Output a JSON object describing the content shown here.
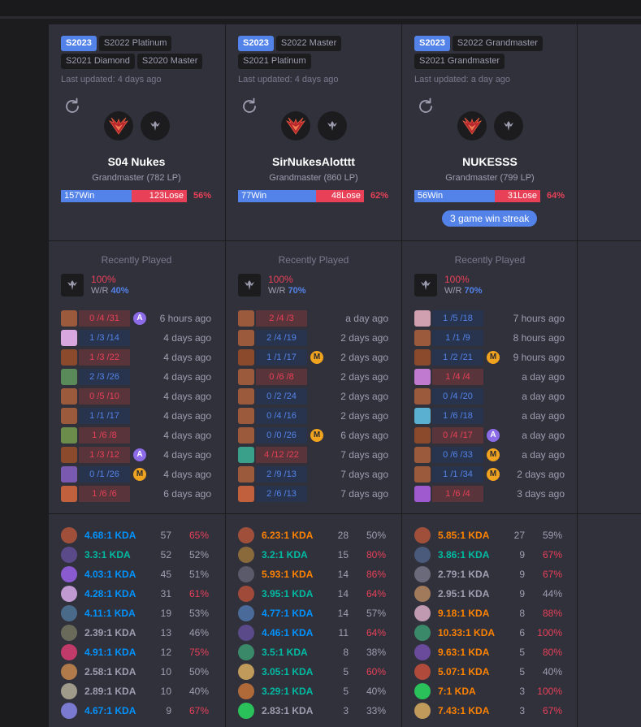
{
  "colors": {
    "win": "#5383e8",
    "lose": "#e84057",
    "bg": "#31313c",
    "dark": "#1c1c1f"
  },
  "recent_played_title": "Recently Played",
  "wr_label": "W/R",
  "players": [
    {
      "seasons": [
        {
          "label": "S2023",
          "current": true
        },
        {
          "label": "S2022 Platinum"
        },
        {
          "label": "S2021 Diamond"
        },
        {
          "label": "S2020 Master"
        }
      ],
      "last_updated": "Last updated: 4 days ago",
      "name": "S04 Nukes",
      "rank": "Grandmaster (782 LP)",
      "wins": "157Win",
      "losses": "123Lose",
      "winrate": "56%",
      "win_fraction": 0.56,
      "streak": "",
      "recent": {
        "pct": "100%",
        "wr": "40%"
      },
      "games": [
        {
          "champ": "#9c5a3c",
          "kda": "0 /4 /31",
          "result": "lose",
          "badge": "A",
          "ago": "6 hours ago"
        },
        {
          "champ": "#d8a7e0",
          "kda": "1 /3 /14",
          "result": "win",
          "badge": "",
          "ago": "4 days ago"
        },
        {
          "champ": "#8b4a2b",
          "kda": "1 /3 /22",
          "result": "lose",
          "badge": "",
          "ago": "4 days ago"
        },
        {
          "champ": "#5a8a5a",
          "kda": "2 /3 /26",
          "result": "win",
          "badge": "",
          "ago": "4 days ago"
        },
        {
          "champ": "#9c5a3c",
          "kda": "0 /5 /10",
          "result": "lose",
          "badge": "",
          "ago": "4 days ago"
        },
        {
          "champ": "#9c5a3c",
          "kda": "1 /1 /17",
          "result": "win",
          "badge": "",
          "ago": "4 days ago"
        },
        {
          "champ": "#6b8c4a",
          "kda": "1 /6 /8",
          "result": "lose",
          "badge": "",
          "ago": "4 days ago"
        },
        {
          "champ": "#8b4a2b",
          "kda": "1 /3 /12",
          "result": "lose",
          "badge": "A",
          "ago": "4 days ago"
        },
        {
          "champ": "#7a5ab0",
          "kda": "0 /1 /26",
          "result": "win",
          "badge": "M",
          "ago": "4 days ago"
        },
        {
          "champ": "#c0603c",
          "kda": "1 /6 /6",
          "result": "lose",
          "badge": "",
          "ago": "6 days ago"
        }
      ],
      "champions": [
        {
          "icon": "#a0503a",
          "kda": "4.68:1 KDA",
          "tier": "blue",
          "games": "57",
          "wr": "65%",
          "hot": true
        },
        {
          "icon": "#5a4a8a",
          "kda": "3.3:1 KDA",
          "tier": "green",
          "games": "52",
          "wr": "52%",
          "hot": false
        },
        {
          "icon": "#8a5ad0",
          "kda": "4.03:1 KDA",
          "tier": "blue",
          "games": "45",
          "wr": "51%",
          "hot": false
        },
        {
          "icon": "#c09ad0",
          "kda": "4.28:1 KDA",
          "tier": "blue",
          "games": "31",
          "wr": "61%",
          "hot": true
        },
        {
          "icon": "#4a6a8a",
          "kda": "4.11:1 KDA",
          "tier": "blue",
          "games": "19",
          "wr": "53%",
          "hot": false
        },
        {
          "icon": "#6a6a5a",
          "kda": "2.39:1 KDA",
          "tier": "gray",
          "games": "13",
          "wr": "46%",
          "hot": false
        },
        {
          "icon": "#c03a6a",
          "kda": "4.91:1 KDA",
          "tier": "blue",
          "games": "12",
          "wr": "75%",
          "hot": true
        },
        {
          "icon": "#b07a4a",
          "kda": "2.58:1 KDA",
          "tier": "gray",
          "games": "10",
          "wr": "50%",
          "hot": false
        },
        {
          "icon": "#a09a8a",
          "kda": "2.89:1 KDA",
          "tier": "gray",
          "games": "10",
          "wr": "40%",
          "hot": false
        },
        {
          "icon": "#7a7ad0",
          "kda": "4.67:1 KDA",
          "tier": "blue",
          "games": "9",
          "wr": "67%",
          "hot": true
        }
      ]
    },
    {
      "seasons": [
        {
          "label": "S2023",
          "current": true
        },
        {
          "label": "S2022 Master"
        },
        {
          "label": "S2021 Platinum"
        }
      ],
      "last_updated": "Last updated: 4 days ago",
      "name": "SirNukesAlotttt",
      "rank": "Grandmaster (860 LP)",
      "wins": "77Win",
      "losses": "48Lose",
      "winrate": "62%",
      "win_fraction": 0.62,
      "streak": "",
      "recent": {
        "pct": "100%",
        "wr": "70%"
      },
      "games": [
        {
          "champ": "#9c5a3c",
          "kda": "2 /4 /3",
          "result": "lose",
          "badge": "",
          "ago": "a day ago"
        },
        {
          "champ": "#9c5a3c",
          "kda": "2 /4 /19",
          "result": "win",
          "badge": "",
          "ago": "2 days ago"
        },
        {
          "champ": "#8b4a2b",
          "kda": "1 /1 /17",
          "result": "win",
          "badge": "M",
          "ago": "2 days ago"
        },
        {
          "champ": "#9c5a3c",
          "kda": "0 /6 /8",
          "result": "lose",
          "badge": "",
          "ago": "2 days ago"
        },
        {
          "champ": "#9c5a3c",
          "kda": "0 /2 /24",
          "result": "win",
          "badge": "",
          "ago": "2 days ago"
        },
        {
          "champ": "#9c5a3c",
          "kda": "0 /4 /16",
          "result": "win",
          "badge": "",
          "ago": "2 days ago"
        },
        {
          "champ": "#9c5a3c",
          "kda": "0 /0 /26",
          "result": "win",
          "badge": "M",
          "ago": "6 days ago"
        },
        {
          "champ": "#3aa08a",
          "kda": "4 /12 /22",
          "result": "lose",
          "badge": "",
          "ago": "7 days ago"
        },
        {
          "champ": "#9c5a3c",
          "kda": "2 /9 /13",
          "result": "win",
          "badge": "",
          "ago": "7 days ago"
        },
        {
          "champ": "#c0603c",
          "kda": "2 /6 /13",
          "result": "win",
          "badge": "",
          "ago": "7 days ago"
        }
      ],
      "champions": [
        {
          "icon": "#a0503a",
          "kda": "6.23:1 KDA",
          "tier": "orange",
          "games": "28",
          "wr": "50%",
          "hot": false
        },
        {
          "icon": "#8a6a3a",
          "kda": "3.2:1 KDA",
          "tier": "green",
          "games": "15",
          "wr": "80%",
          "hot": true
        },
        {
          "icon": "#5a5a6a",
          "kda": "5.93:1 KDA",
          "tier": "orange",
          "games": "14",
          "wr": "86%",
          "hot": true
        },
        {
          "icon": "#a04a3a",
          "kda": "3.95:1 KDA",
          "tier": "green",
          "games": "14",
          "wr": "64%",
          "hot": true
        },
        {
          "icon": "#4a6a9a",
          "kda": "4.77:1 KDA",
          "tier": "blue",
          "games": "14",
          "wr": "57%",
          "hot": false
        },
        {
          "icon": "#5a4a8a",
          "kda": "4.46:1 KDA",
          "tier": "blue",
          "games": "11",
          "wr": "64%",
          "hot": true
        },
        {
          "icon": "#3a8a6a",
          "kda": "3.5:1 KDA",
          "tier": "green",
          "games": "8",
          "wr": "38%",
          "hot": false
        },
        {
          "icon": "#c09a5a",
          "kda": "3.05:1 KDA",
          "tier": "green",
          "games": "5",
          "wr": "60%",
          "hot": true
        },
        {
          "icon": "#b06a3a",
          "kda": "3.29:1 KDA",
          "tier": "green",
          "games": "5",
          "wr": "40%",
          "hot": false
        },
        {
          "icon": "#2ac05a",
          "kda": "2.83:1 KDA",
          "tier": "gray",
          "games": "3",
          "wr": "33%",
          "hot": false
        }
      ]
    },
    {
      "seasons": [
        {
          "label": "S2023",
          "current": true
        },
        {
          "label": "S2022 Grandmaster"
        },
        {
          "label": "S2021 Grandmaster"
        }
      ],
      "last_updated": "Last updated: a day ago",
      "name": "NUKESSS",
      "rank": "Grandmaster (799 LP)",
      "wins": "56Win",
      "losses": "31Lose",
      "winrate": "64%",
      "win_fraction": 0.64,
      "streak": "3 game win streak",
      "recent": {
        "pct": "100%",
        "wr": "70%"
      },
      "games": [
        {
          "champ": "#d0a0b0",
          "kda": "1 /5 /18",
          "result": "win",
          "badge": "",
          "ago": "7 hours ago"
        },
        {
          "champ": "#9c5a3c",
          "kda": "1 /1 /9",
          "result": "win",
          "badge": "",
          "ago": "8 hours ago"
        },
        {
          "champ": "#8b4a2b",
          "kda": "1 /2 /21",
          "result": "win",
          "badge": "M",
          "ago": "9 hours ago"
        },
        {
          "champ": "#c07ad0",
          "kda": "1 /4 /4",
          "result": "lose",
          "badge": "",
          "ago": "a day ago"
        },
        {
          "champ": "#9c5a3c",
          "kda": "0 /4 /20",
          "result": "win",
          "badge": "",
          "ago": "a day ago"
        },
        {
          "champ": "#5ab0d0",
          "kda": "1 /6 /18",
          "result": "win",
          "badge": "",
          "ago": "a day ago"
        },
        {
          "champ": "#8b4a2b",
          "kda": "0 /4 /17",
          "result": "lose",
          "badge": "A",
          "ago": "a day ago"
        },
        {
          "champ": "#9c5a3c",
          "kda": "0 /6 /33",
          "result": "win",
          "badge": "M",
          "ago": "a day ago"
        },
        {
          "champ": "#9c5a3c",
          "kda": "1 /1 /34",
          "result": "win",
          "badge": "M",
          "ago": "2 days ago"
        },
        {
          "champ": "#a05ad0",
          "kda": "1 /6 /4",
          "result": "lose",
          "badge": "",
          "ago": "3 days ago"
        }
      ],
      "champions": [
        {
          "icon": "#a0503a",
          "kda": "5.85:1 KDA",
          "tier": "orange",
          "games": "27",
          "wr": "59%",
          "hot": false
        },
        {
          "icon": "#4a5a7a",
          "kda": "3.86:1 KDA",
          "tier": "green",
          "games": "9",
          "wr": "67%",
          "hot": true
        },
        {
          "icon": "#6a6a7a",
          "kda": "2.79:1 KDA",
          "tier": "gray",
          "games": "9",
          "wr": "67%",
          "hot": true
        },
        {
          "icon": "#a07a5a",
          "kda": "2.95:1 KDA",
          "tier": "gray",
          "games": "9",
          "wr": "44%",
          "hot": false
        },
        {
          "icon": "#c09ab0",
          "kda": "9.18:1 KDA",
          "tier": "orange",
          "games": "8",
          "wr": "88%",
          "hot": true
        },
        {
          "icon": "#3a8a6a",
          "kda": "10.33:1 KDA",
          "tier": "orange",
          "games": "6",
          "wr": "100%",
          "hot": true
        },
        {
          "icon": "#6a4a9a",
          "kda": "9.63:1 KDA",
          "tier": "orange",
          "games": "5",
          "wr": "80%",
          "hot": true
        },
        {
          "icon": "#b04a3a",
          "kda": "5.07:1 KDA",
          "tier": "orange",
          "games": "5",
          "wr": "40%",
          "hot": false
        },
        {
          "icon": "#2ac05a",
          "kda": "7:1 KDA",
          "tier": "orange",
          "games": "3",
          "wr": "100%",
          "hot": true
        },
        {
          "icon": "#c09a5a",
          "kda": "7.43:1 KDA",
          "tier": "orange",
          "games": "3",
          "wr": "67%",
          "hot": true
        }
      ]
    }
  ]
}
